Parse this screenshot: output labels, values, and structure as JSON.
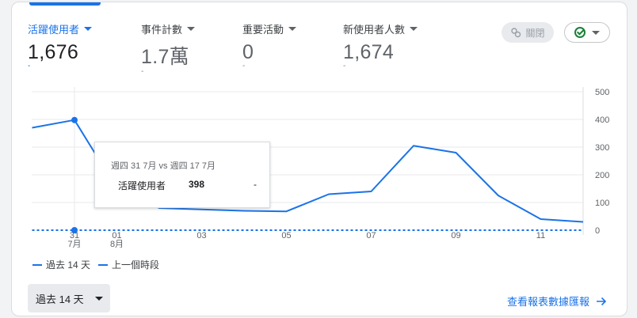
{
  "metrics": [
    {
      "label": "活躍使用者",
      "value": "1,676",
      "change": "-",
      "active": true
    },
    {
      "label": "事件計數",
      "value": "1.7萬",
      "change": "-",
      "active": false
    },
    {
      "label": "重要活動",
      "value": "0",
      "change": "-",
      "active": false
    },
    {
      "label": "新使用者人數",
      "value": "1,674",
      "change": "-",
      "active": false
    }
  ],
  "toolbar": {
    "insights_label": "關閉",
    "insights_icon": "insights-sparkle-icon",
    "status_icon": "check-circle-icon"
  },
  "tooltip": {
    "title": "週四 31 7月 vs 週四 17 7月",
    "metric_name": "活躍使用者",
    "value": "398",
    "comparison": "-"
  },
  "legend": {
    "current": "過去 14 天",
    "previous": "上一個時段"
  },
  "footer": {
    "date_range": "過去 14 天",
    "report_link": "查看報表數據匯報"
  },
  "colors": {
    "accent": "#1a73e8",
    "success": "#188038"
  },
  "chart_data": {
    "type": "line",
    "x_ticks": [
      {
        "day": 0,
        "line1": "31",
        "line2": "7月"
      },
      {
        "day": 1,
        "line1": "01",
        "line2": "8月"
      },
      {
        "day": 3,
        "line1": "03",
        "line2": ""
      },
      {
        "day": 5,
        "line1": "05",
        "line2": ""
      },
      {
        "day": 7,
        "line1": "07",
        "line2": ""
      },
      {
        "day": 9,
        "line1": "09",
        "line2": ""
      },
      {
        "day": 11,
        "line1": "11",
        "line2": ""
      }
    ],
    "ylim": [
      0,
      500
    ],
    "y_ticks": [
      0,
      100,
      200,
      300,
      400,
      500
    ],
    "series": [
      {
        "name": "過去 14 天",
        "style": "solid",
        "x": [
          -1,
          0,
          1,
          2,
          3,
          4,
          5,
          6,
          7,
          8,
          9,
          10,
          11,
          12
        ],
        "y": [
          370,
          398,
          150,
          80,
          75,
          70,
          68,
          130,
          140,
          305,
          280,
          125,
          40,
          30
        ]
      },
      {
        "name": "上一個時段",
        "style": "dashed",
        "x": [
          -1,
          0,
          12
        ],
        "y": [
          0,
          0,
          0
        ]
      }
    ],
    "highlight_x": 0,
    "grid": true
  }
}
